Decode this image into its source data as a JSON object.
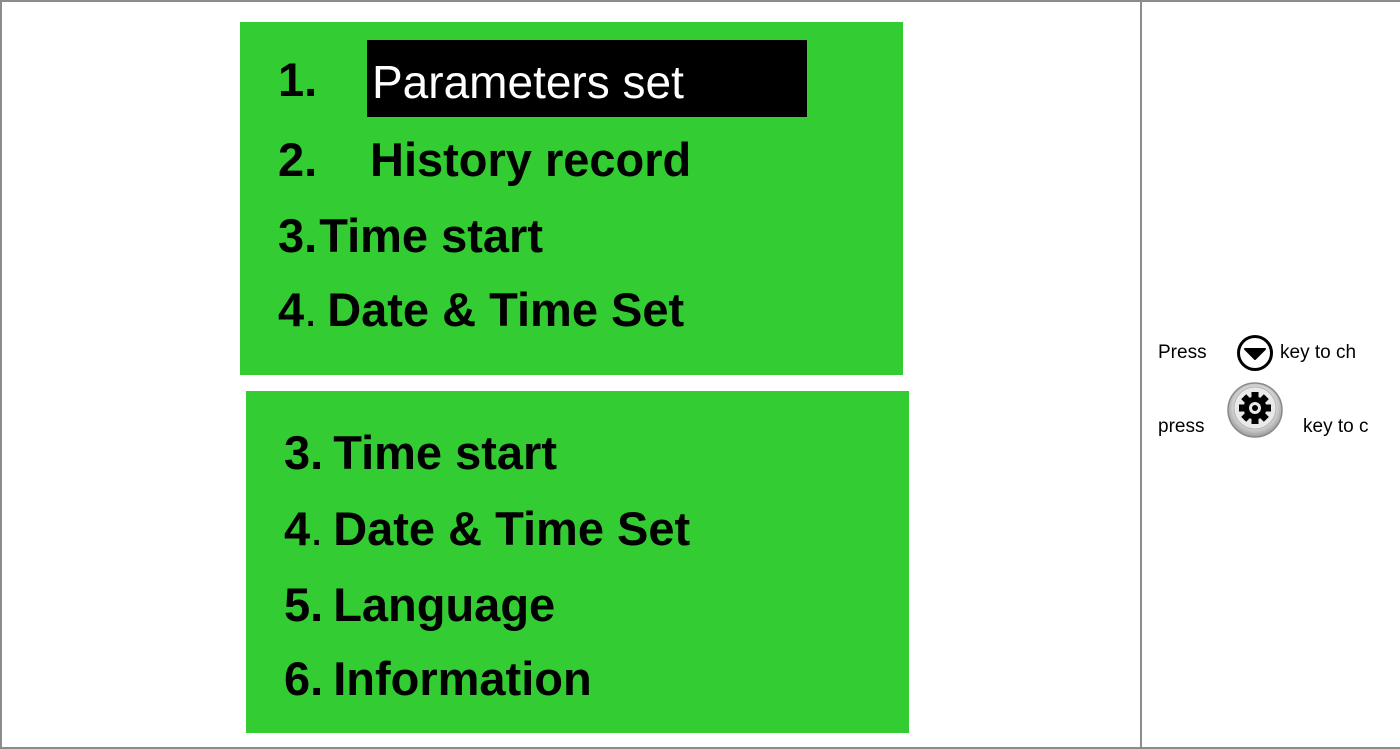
{
  "lcd_screen_1": {
    "items": [
      {
        "number": "1.",
        "label": "Parameters set",
        "selected": true
      },
      {
        "number": "2.",
        "label": "History record",
        "selected": false
      },
      {
        "number": "3.",
        "label": "Time start",
        "selected": false
      },
      {
        "number": "4",
        "dot": ".",
        "label": "Date & Time Set",
        "selected": false
      }
    ],
    "background_color": "#33cc33",
    "highlight_color": "#000000"
  },
  "lcd_screen_2": {
    "items": [
      {
        "number": "3.",
        "label": "Time start"
      },
      {
        "number": "4",
        "dot": ".",
        "label": "Date & Time Set"
      },
      {
        "number": "5.",
        "label": "Language"
      },
      {
        "number": "6.",
        "label": "Information"
      }
    ]
  },
  "instructions": {
    "line1_prefix": "Press",
    "line1_icon": "down-arrow-key-icon",
    "line1_suffix": "key to ch",
    "line2_prefix": "press",
    "line2_icon": "gear-key-icon",
    "line2_suffix": "key to c"
  }
}
